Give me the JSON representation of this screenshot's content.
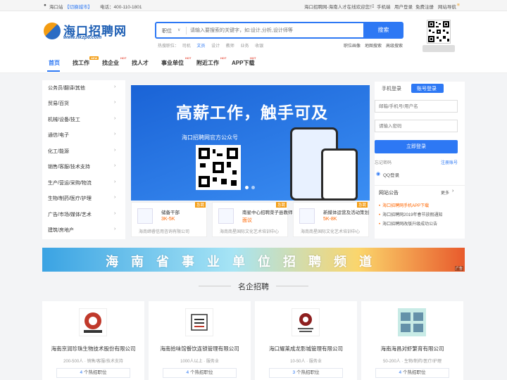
{
  "topbar": {
    "city": "海口站",
    "switch_city": "【切换城市】",
    "phone": "电话：400-110-1801",
    "slogan": "海口招聘网-海南人才在线欢迎您！",
    "mobile": "手机端",
    "login": "用户登录",
    "register": "免费注册",
    "site_nav": "网站导航"
  },
  "logo": {
    "name": "海口招聘网",
    "url": "www.hkzp6.com"
  },
  "search": {
    "type_label": "职位",
    "placeholder": "请输入要搜索的关键字，如:设计,分析,设计师等",
    "button": "搜索",
    "hot_label": "热搜职位：",
    "hot_items": [
      "司机",
      "文员",
      "设计",
      "教师",
      "业务",
      "收银"
    ],
    "links": [
      "职位画像",
      "地图搜索",
      "高级搜索"
    ]
  },
  "nav": {
    "items": [
      "首页",
      "找工作",
      "找企业",
      "找人才",
      "事业单位",
      "附近工作",
      "APP下载"
    ],
    "badges": {
      "new": "NEW",
      "hot": "HOT"
    }
  },
  "categories": [
    "公务员/翻译/其他",
    "贸易/百货",
    "机械/设备/技工",
    "通信/电子",
    "化工/能源",
    "销售/客服/技术支持",
    "生产/营运/采购/物流",
    "生物/制药/医疗/护理",
    "广告/市场/媒体/艺术",
    "建筑/房地产"
  ],
  "banner": {
    "title": "高薪工作，触手可及",
    "subtitle": "海口招聘网官方公众号"
  },
  "jobs": [
    {
      "name": "储备干部",
      "salary": "3K-5K",
      "company": "海南缔睿信用咨询有限公司",
      "tag": "急聘"
    },
    {
      "name": "南星中心招聘菜子县教师",
      "salary": "面议",
      "company": "海南南星国际文化艺术培训中心",
      "tag": "急聘"
    },
    {
      "name": "新媒体运营及活动策划",
      "salary": "5K-8K",
      "company": "海南南星国际文化艺术培训中心",
      "tag": "急聘"
    }
  ],
  "login": {
    "tab_mobile": "手机登录",
    "tab_account": "账号登录",
    "username_placeholder": "邮箱/手机号/用户名",
    "password_placeholder": "请输入密码",
    "submit": "立即登录",
    "forgot": "忘记密码",
    "register": "注册账号",
    "qq": "QQ登录"
  },
  "notice": {
    "title": "网站公告",
    "more": "更多",
    "items": [
      "海口招聘网手机APP下载",
      "海口招聘网2019年春节放假通知",
      "海口招聘网改版升级成功公告"
    ]
  },
  "wide_banner": {
    "text": "海南省事业单位招聘频道",
    "ad": "广告"
  },
  "section": {
    "title": "名企招聘"
  },
  "companies": [
    {
      "name": "海南京润珍珠生物技术股份有限公司",
      "meta": "200-500人 · 销售/客服/技术支持",
      "count": "4",
      "suffix": "个热招职位"
    },
    {
      "name": "海南拾味馆餐饮连锁管理有限公司",
      "meta": "1000人以上 · 服务业",
      "count": "4",
      "suffix": "个热招职位"
    },
    {
      "name": "海口耀莱成龙影城管理有限公司",
      "meta": "10-50人 · 服务业",
      "count": "3",
      "suffix": "个热招职位"
    },
    {
      "name": "海南海昌对虾繁育有限公司",
      "meta": "50-200人 · 生物/制药/医疗/护理",
      "count": "4",
      "suffix": "个热招职位"
    }
  ],
  "colors": {
    "brand_blue": "#2d78f4",
    "salary_orange": "#ff6600",
    "tag_orange": "#f39c12"
  }
}
